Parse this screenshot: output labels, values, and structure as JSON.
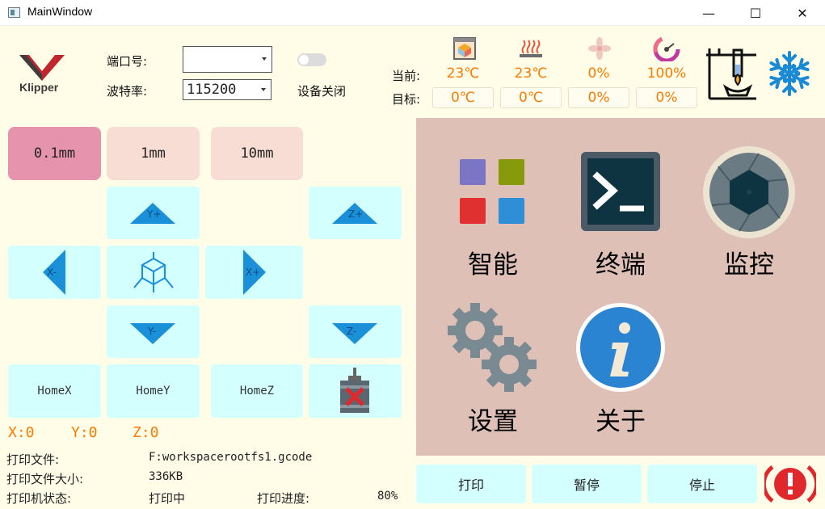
{
  "window": {
    "title": "MainWindow",
    "minimize": "—",
    "maximize": "☐",
    "close": "✕"
  },
  "logo": {
    "text": "Klipper"
  },
  "serial": {
    "port_label": "端口号:",
    "port_value": "",
    "baud_label": "波特率:",
    "baud_value": "115200",
    "device_status": "设备关闭",
    "toggle_on": false
  },
  "temps": {
    "current_label": "当前:",
    "target_label": "目标:",
    "current": [
      "23℃",
      "23℃",
      "0%",
      "100%"
    ],
    "target": [
      "0℃",
      "0℃",
      "0%",
      "0%"
    ],
    "icons": [
      "extruder-icon",
      "heated-bed-icon",
      "fan-icon",
      "speed-gauge-icon"
    ]
  },
  "extra_icons": [
    "heating-apparatus-icon",
    "snowflake-icon"
  ],
  "step": {
    "options": [
      "0.1mm",
      "1mm",
      "10mm"
    ],
    "selected": "0.1mm"
  },
  "jog": {
    "y_plus": "Y+",
    "y_minus": "Y-",
    "x_minus": "X-",
    "x_plus": "X+",
    "z_plus": "Z+",
    "z_minus": "Z-"
  },
  "home": {
    "x": "HomeX",
    "y": "HomeY",
    "z": "HomeZ"
  },
  "position": {
    "x": "X:0",
    "y": "Y:0",
    "z": "Z:0"
  },
  "print_info": {
    "file_label": "打印文件:",
    "file_value": "F:workspacerootfs1.gcode",
    "size_label": "打印文件大小:",
    "size_value": "336KB",
    "status_label": "打印机状态:",
    "status_value": "打印中",
    "progress_label": "打印进度:",
    "progress_value": "80%"
  },
  "menu": {
    "smart": "智能",
    "terminal": "终端",
    "monitor": "监控",
    "settings": "设置",
    "about": "关于"
  },
  "actions": {
    "print": "打印",
    "pause": "暂停",
    "stop": "停止"
  },
  "colors": {
    "accent_orange": "#ff7a00",
    "jog_cyan": "#d4ffff",
    "arrow_blue": "#1a90d8",
    "panel_rose": "#dfc0b6",
    "step_selected": "#e693ad",
    "step_normal": "#f7ddd3",
    "emergency_red": "#e0282c"
  }
}
